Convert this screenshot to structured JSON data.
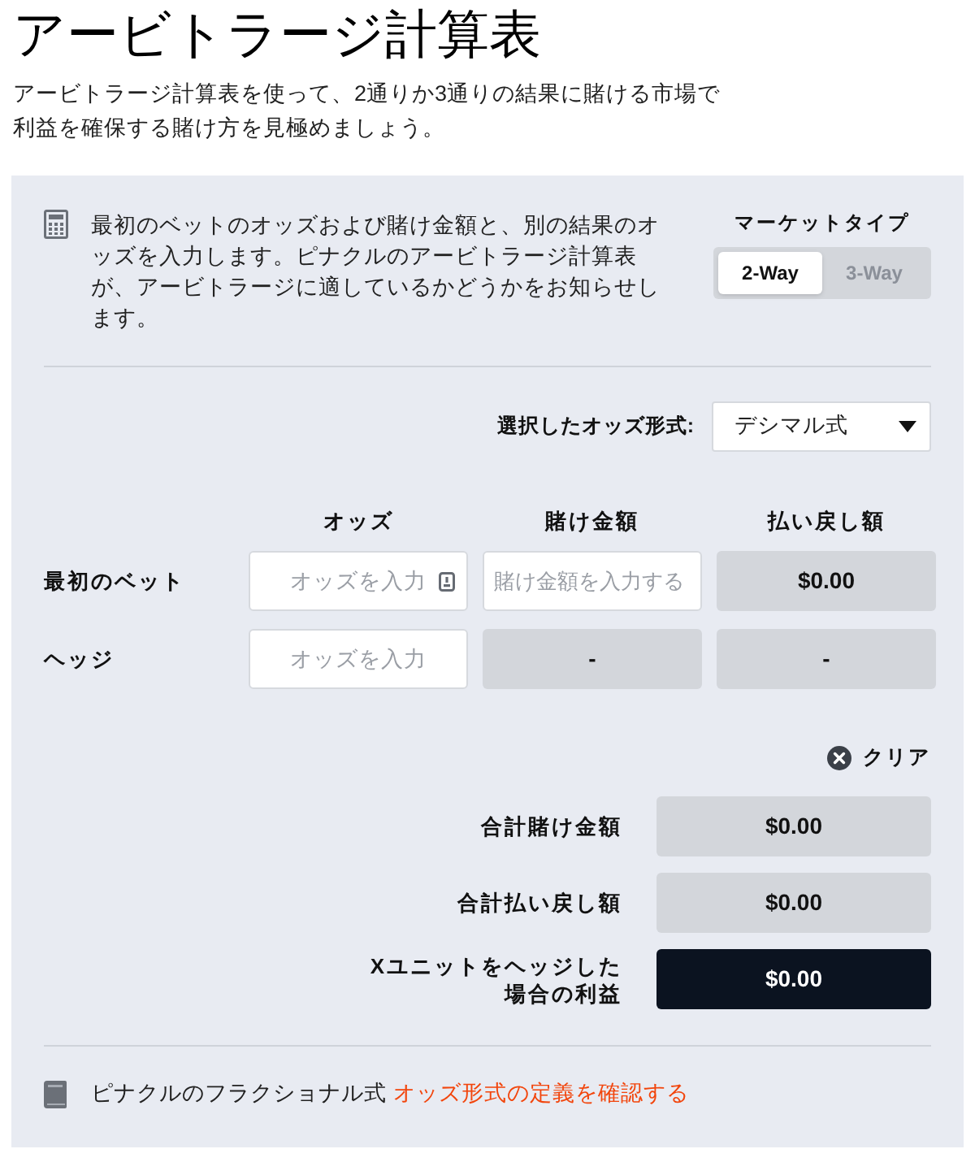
{
  "title": "アービトラージ計算表",
  "intro": "アービトラージ計算表を使って、2通りか3通りの結果に賭ける市場で利益を確保する賭け方を見極めましょう。",
  "calculator": {
    "description": "最初のベットのオッズおよび賭け金額と、別の結果のオッズを入力します。ピナクルのアービトラージ計算表が、アービトラージに適しているかどうかをお知らせします。",
    "market_type": {
      "label": "マーケットタイプ",
      "options": [
        {
          "label": "2-Way",
          "selected": true
        },
        {
          "label": "3-Way",
          "selected": false
        }
      ]
    },
    "odds_format": {
      "label": "選択したオッズ形式:",
      "value": "デシマル式"
    },
    "table": {
      "columns": [
        "オッズ",
        "賭け金額",
        "払い戻し額"
      ],
      "rows": [
        {
          "label": "最初のベット",
          "odds": {
            "placeholder": "オッズを入力",
            "autofill_badge": true
          },
          "stake": {
            "kind": "input",
            "placeholder": "賭け金額を入力する"
          },
          "payout": "$0.00"
        },
        {
          "label": "ヘッジ",
          "odds": {
            "placeholder": "オッズを入力",
            "autofill_badge": false
          },
          "stake": {
            "kind": "readout",
            "value": "-"
          },
          "payout": "-"
        }
      ]
    },
    "clear_button": "クリア",
    "totals": [
      {
        "label": "合計賭け金額",
        "value": "$0.00",
        "kind": "plain"
      },
      {
        "label": "合計払い戻し額",
        "value": "$0.00",
        "kind": "plain"
      },
      {
        "label": "Xユニットをヘッジした場合の利益",
        "value": "$0.00",
        "kind": "highlight"
      }
    ],
    "footer": {
      "text": "ピナクルのフラクショナル式",
      "link": "オッズ形式の定義を確認する"
    }
  }
}
